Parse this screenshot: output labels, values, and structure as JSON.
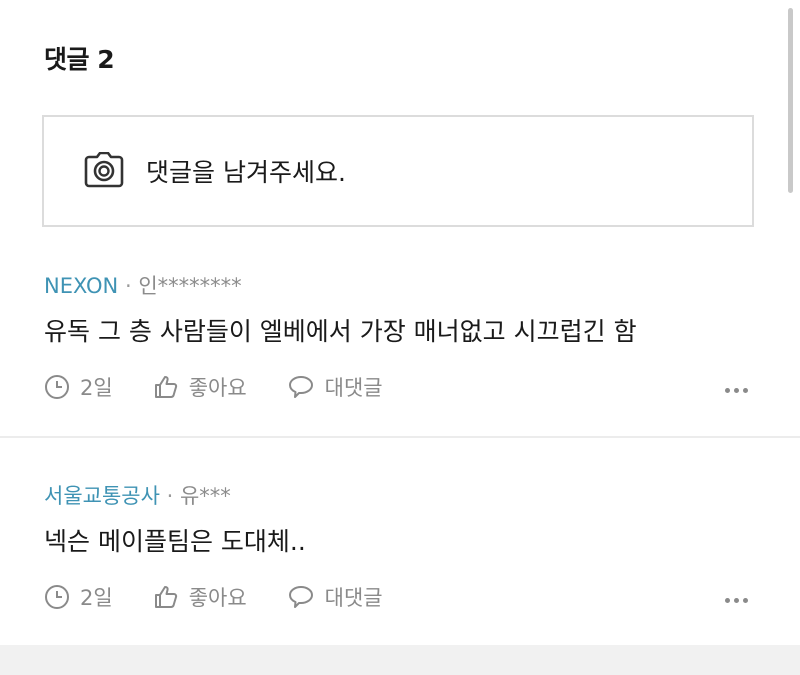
{
  "header": {
    "title": "댓글 2"
  },
  "input": {
    "placeholder": "댓글을 남겨주세요.",
    "icon": "camera-icon"
  },
  "comments": [
    {
      "author": "NEXON",
      "separator": "·",
      "user": "인********",
      "body": "유독 그 층 사람들이 엘베에서 가장 매너없고 시끄럽긴 함",
      "time": "2일",
      "like_label": "좋아요",
      "reply_label": "대댓글"
    },
    {
      "author": "서울교통공사",
      "separator": "·",
      "user": "유***",
      "body": "넥슨 메이플팀은 도대체..",
      "time": "2일",
      "like_label": "좋아요",
      "reply_label": "대댓글"
    }
  ],
  "colors": {
    "author": "#3f93b4",
    "meta": "#8a8a8a",
    "border": "#dcdcdc"
  }
}
